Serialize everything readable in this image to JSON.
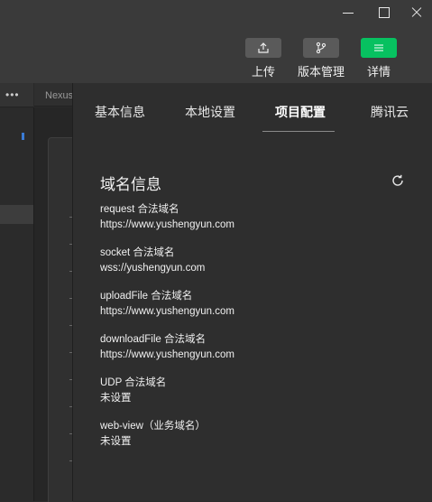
{
  "window": {
    "minimize": "minimize",
    "maximize": "maximize",
    "close": "close"
  },
  "toolbar": {
    "upload": {
      "label": "上传",
      "icon": "upload-icon",
      "color": "#5a5a5a"
    },
    "version": {
      "label": "版本管理",
      "icon": "branch-icon",
      "color": "#5a5a5a"
    },
    "detail": {
      "label": "详情",
      "icon": "menu-icon",
      "color": "#07c160"
    }
  },
  "editor": {
    "tab_label": "Nexus"
  },
  "tabs": [
    {
      "label": "基本信息",
      "active": false
    },
    {
      "label": "本地设置",
      "active": false
    },
    {
      "label": "项目配置",
      "active": true
    },
    {
      "label": "腾讯云",
      "active": false
    }
  ],
  "domain": {
    "title": "域名信息",
    "refresh_icon": "refresh-icon",
    "items": [
      {
        "key": "request 合法域名",
        "value": "https://www.yushengyun.com"
      },
      {
        "key": "socket 合法域名",
        "value": "wss://yushengyun.com"
      },
      {
        "key": "uploadFile 合法域名",
        "value": "https://www.yushengyun.com"
      },
      {
        "key": "downloadFile 合法域名",
        "value": "https://www.yushengyun.com"
      },
      {
        "key": "UDP 合法域名",
        "value": "未设置"
      },
      {
        "key": "web-view（业务域名）",
        "value": "未设置"
      }
    ]
  }
}
